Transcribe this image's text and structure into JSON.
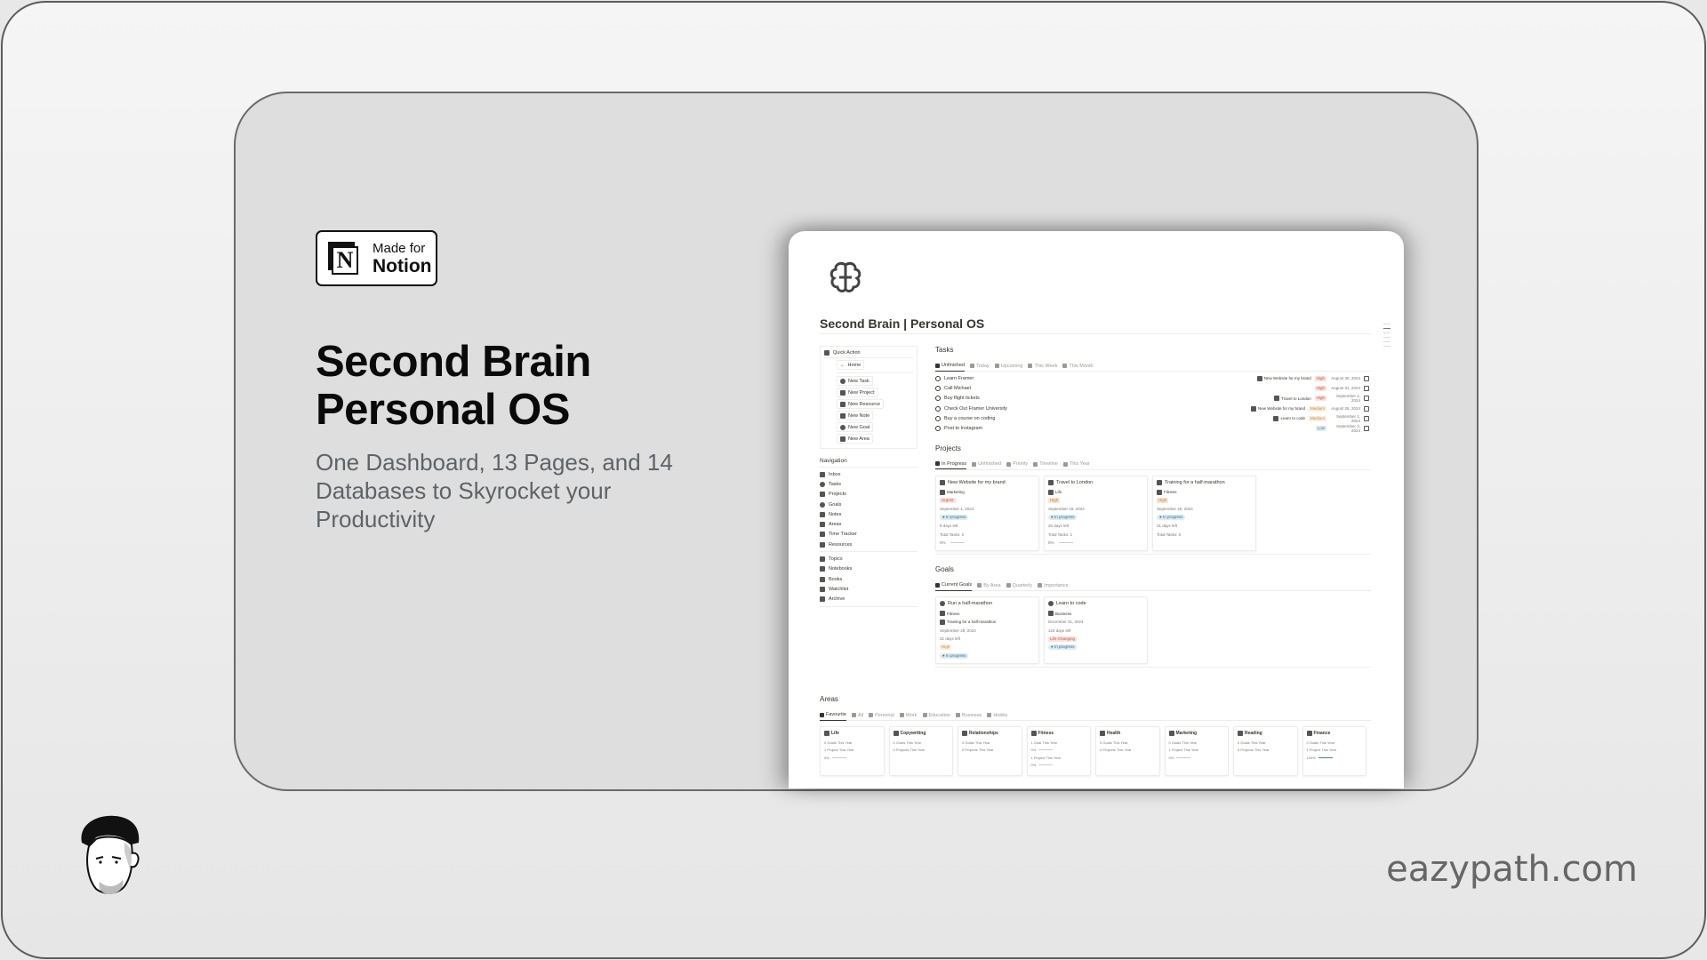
{
  "badge": {
    "line1": "Made for",
    "line2": "Notion",
    "logo_letter": "N"
  },
  "hero": {
    "title_line1": "Second Brain",
    "title_line2": "Personal OS",
    "subtitle": "One Dashboard, 13 Pages, and 14 Databases to Skyrocket your Productivity"
  },
  "page": {
    "icon": "brain-icon",
    "title": "Second Brain | Personal OS"
  },
  "quick_action": {
    "title": "Quick Action",
    "home": "Home",
    "buttons": [
      "New Task",
      "New Project",
      "New Resource",
      "New Note",
      "New Goal",
      "New Area"
    ]
  },
  "navigation": {
    "title": "Navigation",
    "group1": [
      "Inbox",
      "Tasks",
      "Projects",
      "Goals",
      "Notes",
      "Areas",
      "Time Tracker",
      "Resources"
    ],
    "group2": [
      "Topics",
      "Notebooks",
      "Books",
      "Watchlist",
      "Archive"
    ]
  },
  "tasks": {
    "title": "Tasks",
    "tabs": [
      "Unfinished",
      "Today",
      "Upcoming",
      "This Week",
      "This Month"
    ],
    "rows": [
      {
        "name": "Learn Framer",
        "project": "New Website for my brand",
        "priority": "High",
        "date": "August 30, 2024"
      },
      {
        "name": "Call Michael",
        "project": "",
        "priority": "High",
        "date": "August 31, 2024"
      },
      {
        "name": "Buy flight tickets",
        "project": "Travel to London",
        "priority": "High",
        "date": "September 2, 2024"
      },
      {
        "name": "Check Out Framer University",
        "project": "New Website for my brand",
        "priority": "Medium",
        "date": "August 28, 2024"
      },
      {
        "name": "Buy a course on coding",
        "project": "Learn to code",
        "priority": "Medium",
        "date": "September 1, 2024"
      },
      {
        "name": "Post to Instagram",
        "project": "",
        "priority": "Low",
        "date": "September 3, 2024"
      }
    ]
  },
  "projects": {
    "title": "Projects",
    "tabs": [
      "In Progress",
      "Unfinished",
      "Priority",
      "Timeline",
      "This Year"
    ],
    "cards": [
      {
        "name": "New Website for my brand",
        "area": "Marketing",
        "priority": "Urgent",
        "date": "September 1, 2024",
        "status": "In progress",
        "days_left": "9 days left",
        "total_tasks": "Total Tasks: 2",
        "progress": "0%"
      },
      {
        "name": "Travel to London",
        "area": "Life",
        "priority": "High",
        "date": "September 18, 2024",
        "status": "In progress",
        "days_left": "20 days left",
        "total_tasks": "Total Tasks: 1",
        "progress": "0%"
      },
      {
        "name": "Training for a half-marathon",
        "area": "Fitness",
        "priority": "High",
        "date": "September 29, 2024",
        "status": "In progress",
        "days_left": "31 days left",
        "total_tasks": "Total Tasks: 0",
        "progress": ""
      }
    ]
  },
  "goals": {
    "title": "Goals",
    "tabs": [
      "Current Goals",
      "By Area",
      "Quarterly",
      "Importance"
    ],
    "cards": [
      {
        "name": "Run a half-marathon",
        "area": "Fitness",
        "project": "Training for a half-marathon",
        "date": "September 29, 2024",
        "days_left": "31 days left",
        "importance": "High",
        "status": "In progress"
      },
      {
        "name": "Learn to code",
        "area": "Business",
        "project": "",
        "date": "December 31, 2024",
        "days_left": "124 days left",
        "importance": "Life-Changing",
        "status": "In progress"
      }
    ]
  },
  "areas": {
    "title": "Areas",
    "tabs": [
      "Favourite",
      "All",
      "Personal",
      "Work",
      "Education",
      "Business",
      "Hobby"
    ],
    "cards": [
      {
        "name": "Life",
        "lines": [
          "0 Goals This Year",
          "1 Project This Year",
          "0%"
        ]
      },
      {
        "name": "Copywriting",
        "lines": [
          "0 Goals This Year",
          "0 Projects This Year"
        ]
      },
      {
        "name": "Relationships",
        "lines": [
          "0 Goals This Year",
          "0 Projects This Year"
        ]
      },
      {
        "name": "Fitness",
        "lines": [
          "1 Goal This Year",
          "0%",
          "1 Project This Year",
          "0%"
        ]
      },
      {
        "name": "Health",
        "lines": [
          "0 Goals This Year",
          "0 Projects This Year"
        ]
      },
      {
        "name": "Marketing",
        "lines": [
          "0 Goals This Year",
          "1 Project This Year",
          "0%"
        ]
      },
      {
        "name": "Reading",
        "lines": [
          "0 Goals This Year",
          "0 Projects This Year"
        ]
      },
      {
        "name": "Finance",
        "lines": [
          "0 Goals This Year",
          "1 Project This Year",
          "100%"
        ]
      }
    ]
  },
  "footer": {
    "site": "eazypath.com",
    "avatar": "author-avatar-illustration"
  },
  "colors": {
    "high_bg": "#fde2dd",
    "medium_bg": "#fbecdd",
    "low_bg": "#ddebf1",
    "progress_full": "#4b8a6f"
  }
}
